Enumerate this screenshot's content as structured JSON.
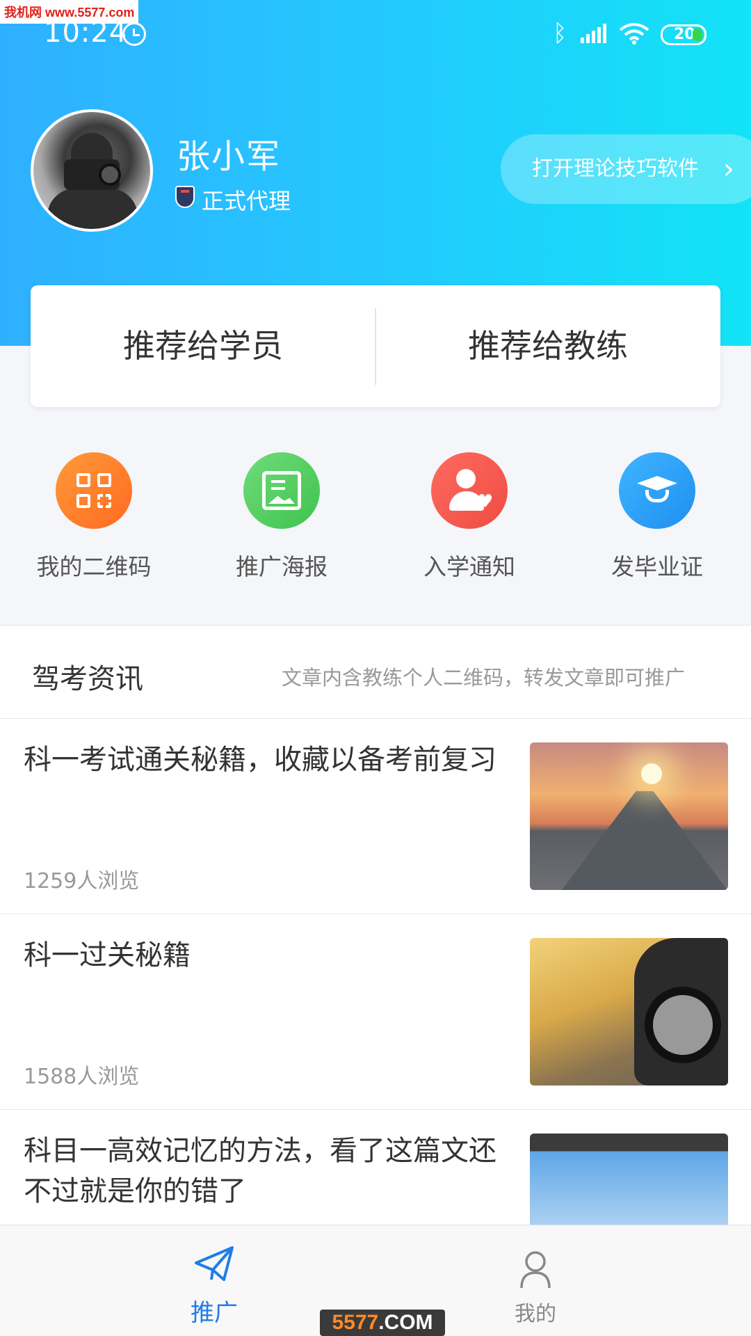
{
  "watermark": {
    "text": "我机网 www.5577.com"
  },
  "status_bar": {
    "time": "10:24",
    "battery": "20"
  },
  "profile": {
    "name": "张小军",
    "badge": "正式代理",
    "open_app_button": "打开理论技巧软件"
  },
  "recommend": {
    "to_students": "推荐给学员",
    "to_coaches": "推荐给教练"
  },
  "quick_actions": [
    {
      "label": "我的二维码",
      "icon": "qr-code-icon",
      "color": "#ff7a2a"
    },
    {
      "label": "推广海报",
      "icon": "poster-icon",
      "color": "#4cc95a"
    },
    {
      "label": "入学通知",
      "icon": "user-heart-icon",
      "color": "#f15a50"
    },
    {
      "label": "发毕业证",
      "icon": "graduation-cap-icon",
      "color": "#2b9df5"
    }
  ],
  "news": {
    "title": "驾考资讯",
    "note": "文章内含教练个人二维码，转发文章即可推广",
    "articles": [
      {
        "title": "科一考试通关秘籍，收藏以备考前复习",
        "views": "1259人浏览"
      },
      {
        "title": "科一过关秘籍",
        "views": "1588人浏览"
      },
      {
        "title": "科目一高效记忆的方法，看了这篇文还不过就是你的错了",
        "views": ""
      }
    ]
  },
  "tabbar": {
    "promote": "推广",
    "mine": "我的",
    "active_color": "#1e7de8"
  },
  "bottom_watermark": {
    "prefix": "5577",
    "suffix": ".COM"
  }
}
